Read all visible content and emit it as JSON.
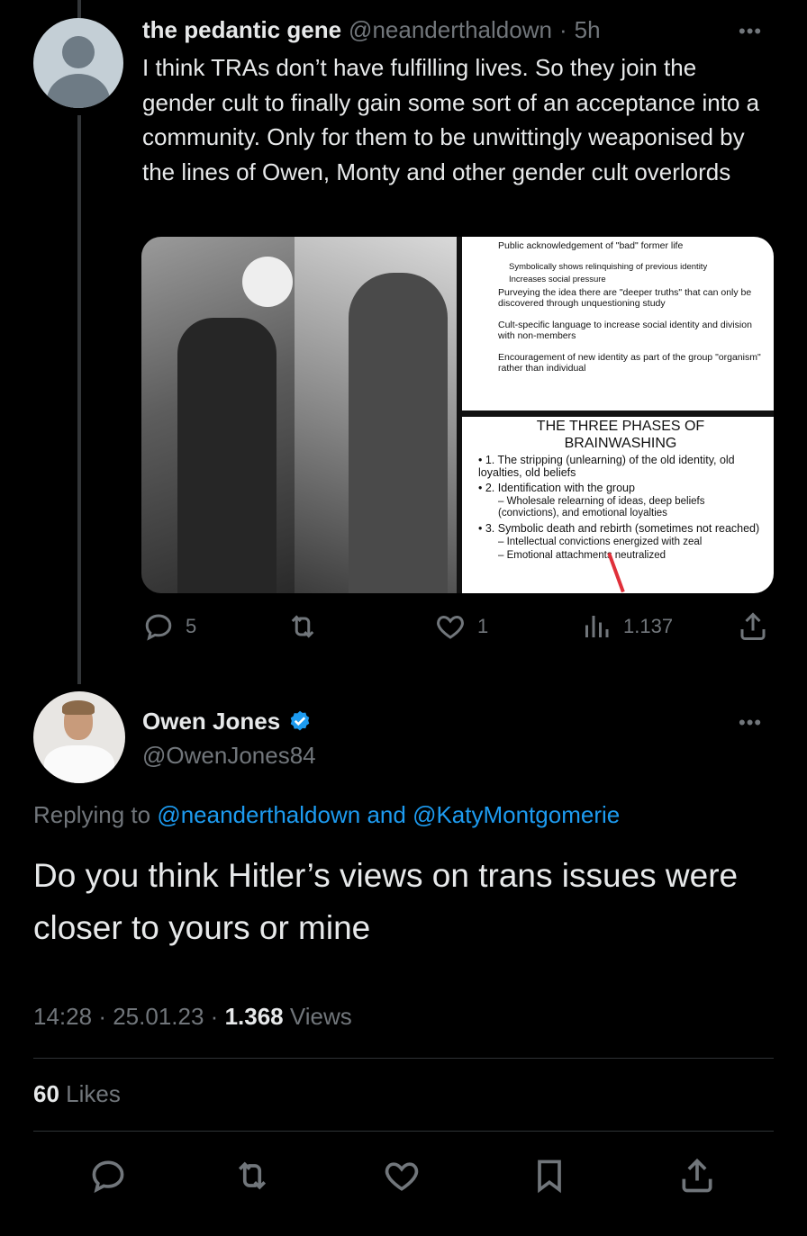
{
  "parent_tweet": {
    "name": "the pedantic gene",
    "handle": "@neanderthaldown",
    "separator": "·",
    "age": "5h",
    "more": "•••",
    "text": "I think TRAs don’t have fulfilling lives. So they join the gender cult to finally gain some sort of an acceptance into a community. Only for them to be unwittingly weaponised by the lines of Owen, Monty and other gender cult overlords",
    "media": {
      "slide_top": {
        "lines": [
          "Public acknowledgement of \"bad\" former life",
          "Symbolically shows relinquishing of previous identity",
          "Increases social pressure",
          "Purveying the idea there are \"deeper truths\" that can only be discovered through unquestioning study",
          "Cult-specific language to increase social identity and division with non-members",
          "Encouragement of new identity as part of the group \"organism\" rather than individual"
        ]
      },
      "slide_bottom": {
        "title_1": "THE THREE PHASES OF",
        "title_2": "BRAINWASHING",
        "points": [
          "• 1. The stripping (unlearning) of the old identity, old loyalties, old beliefs",
          "• 2. Identification with the group",
          "– Wholesale relearning of ideas, deep beliefs (convictions), and emotional loyalties",
          "• 3. Symbolic death and rebirth (sometimes not reached)",
          "– Intellectual convictions energized with zeal",
          "– Emotional attachments neutralized"
        ]
      }
    },
    "actions": {
      "replies": "5",
      "retweets": "",
      "likes": "1",
      "views": "1.137"
    }
  },
  "main_tweet": {
    "name": "Owen Jones",
    "handle": "@OwenJones84",
    "more": "•••",
    "replying_prefix": "Replying to",
    "replying_to_1": "@neanderthaldown",
    "replying_and": "and",
    "replying_to_2": "@KatyMontgomerie",
    "text": "Do you think Hitler’s views on trans issues were closer to yours or mine",
    "time": "14:28",
    "date": "25.01.23",
    "dot": "·",
    "views_count": "1.368",
    "views_label": "Views",
    "likes_count": "60",
    "likes_label": "Likes"
  },
  "colors": {
    "background": "#000000",
    "text": "#e7e9ea",
    "muted": "#71767b",
    "link": "#1d9bf0",
    "divider": "#2f3336"
  },
  "icons": [
    "reply-icon",
    "retweet-icon",
    "like-icon",
    "views-icon",
    "share-icon",
    "bookmark-icon",
    "verified-icon"
  ]
}
